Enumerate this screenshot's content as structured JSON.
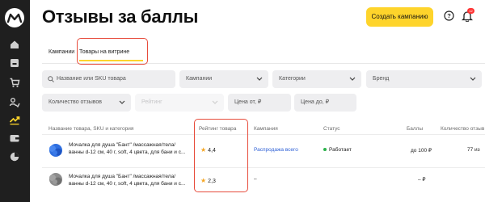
{
  "header": {
    "title": "Отзывы за баллы",
    "create_button": "Создать кампанию",
    "notification_count": "12"
  },
  "tabs": [
    {
      "label": "Кампании"
    },
    {
      "label": "Товары на витрине"
    }
  ],
  "filters": {
    "search_placeholder": "Название или SKU товара",
    "campaign": "Кампании",
    "category": "Категории",
    "brand": "Бренд",
    "reviews_count": "Количество отзывов",
    "rating": "Рейтинг",
    "price_from": "Цена от, ₽",
    "price_to": "Цена до, ₽"
  },
  "table": {
    "columns": [
      "Название товара, SKU и категория",
      "Рейтинг товара",
      "Кампания",
      "Статус",
      "Баллы",
      "Количество отзыв"
    ],
    "rows": [
      {
        "name": "Мочалка для душа \"Бант\" /массажная/тела/ ванны d-12 см, 40 г, soft, 4 цвета, для бани и с...",
        "rating": "4,4",
        "campaign": "Распродажа всего",
        "status": "Работает",
        "points": "до 100 ₽",
        "reviews": "77 из"
      },
      {
        "name": "Мочалка для душа \"Бант\" /массажная/тела/ ванны d-12 см, 40 г, soft, 4 цвета, для бани и с...",
        "rating": "2,3",
        "campaign": "–",
        "status": "",
        "points": "– ₽",
        "reviews": ""
      }
    ]
  },
  "sidebar": {
    "icons": [
      "home-icon",
      "dashboard-icon",
      "cart-icon",
      "people-icon",
      "chart-trend-icon",
      "wallet-icon",
      "pie-chart-icon"
    ]
  },
  "colors": {
    "accent": "#fed42b",
    "sidebar_bg": "#1f1f1f",
    "link": "#2c5fd6",
    "status_ok": "#2bb34b",
    "highlight": "#e74c3c"
  }
}
